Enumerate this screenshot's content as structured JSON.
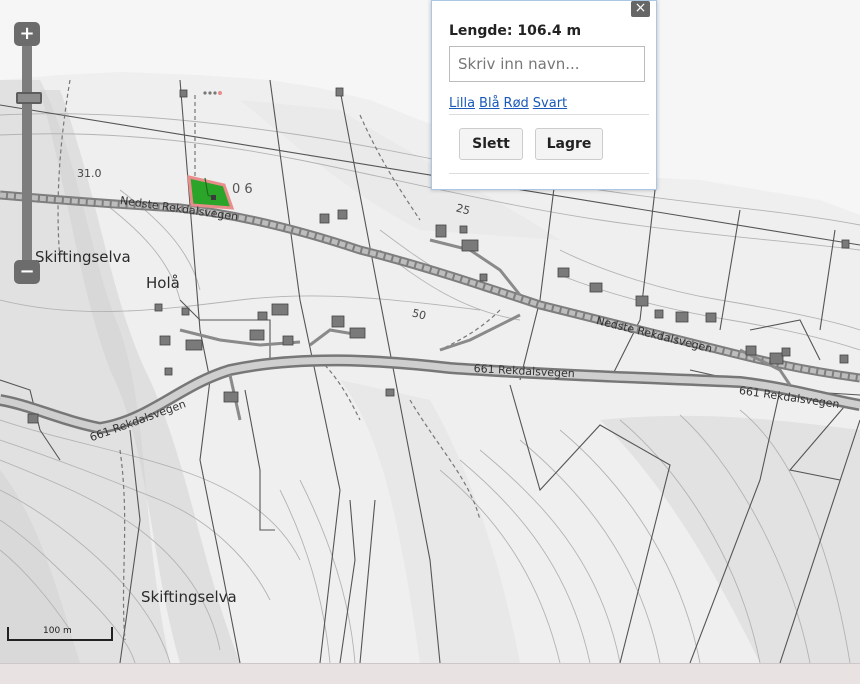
{
  "map": {
    "place_labels": [
      "Skiftingselva",
      "Holå",
      "Skiftingselva"
    ],
    "contour_labels": [
      "31.0",
      "25",
      "50"
    ],
    "road_labels": [
      "Nedste Rekdalsvegen",
      "Nedste Rekdalsvegen",
      "661 Rekdalsvegen",
      "661 Rekdalsvegen",
      "661 Rekdalsvegen"
    ],
    "parcel_label": "0 6",
    "scale_label": "100 m",
    "colors": {
      "measure_fill": "#2aa52a",
      "measure_outline": "#e88c8c",
      "road": "#8a8a8a",
      "terrain": "#efefef"
    }
  },
  "zoom": {
    "in_label": "+",
    "out_label": "−"
  },
  "popup": {
    "close_label": "×",
    "length_text": "Lengde: 106.4 m",
    "name_placeholder": "Skriv inn navn...",
    "colors": [
      "Lilla",
      "Blå",
      "Rød",
      "Svart"
    ],
    "delete_label": "Slett",
    "save_label": "Lagre"
  }
}
